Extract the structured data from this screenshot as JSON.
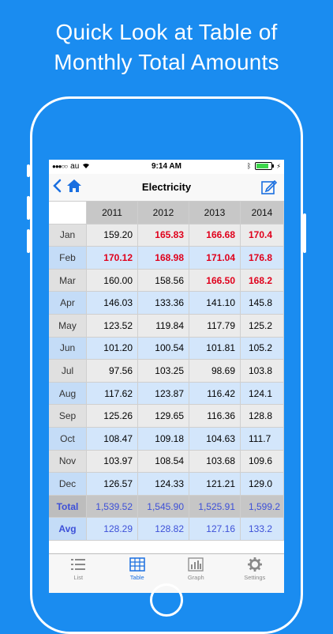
{
  "headline": {
    "line1": "Quick Look at Table of",
    "line2": "Monthly Total Amounts"
  },
  "status": {
    "carrier": "au",
    "time": "9:14 AM"
  },
  "nav": {
    "title": "Electricity"
  },
  "table": {
    "years": [
      "2011",
      "2012",
      "2013",
      "2014"
    ],
    "rows": [
      {
        "month": "Jan",
        "values": [
          "159.20",
          "165.83",
          "166.68",
          "170.4"
        ],
        "red": [
          false,
          true,
          true,
          true
        ]
      },
      {
        "month": "Feb",
        "values": [
          "170.12",
          "168.98",
          "171.04",
          "176.8"
        ],
        "red": [
          true,
          true,
          true,
          true
        ]
      },
      {
        "month": "Mar",
        "values": [
          "160.00",
          "158.56",
          "166.50",
          "168.2"
        ],
        "red": [
          false,
          false,
          true,
          true
        ]
      },
      {
        "month": "Apr",
        "values": [
          "146.03",
          "133.36",
          "141.10",
          "145.8"
        ],
        "red": [
          false,
          false,
          false,
          false
        ]
      },
      {
        "month": "May",
        "values": [
          "123.52",
          "119.84",
          "117.79",
          "125.2"
        ],
        "red": [
          false,
          false,
          false,
          false
        ]
      },
      {
        "month": "Jun",
        "values": [
          "101.20",
          "100.54",
          "101.81",
          "105.2"
        ],
        "red": [
          false,
          false,
          false,
          false
        ]
      },
      {
        "month": "Jul",
        "values": [
          "97.56",
          "103.25",
          "98.69",
          "103.8"
        ],
        "red": [
          false,
          false,
          false,
          false
        ]
      },
      {
        "month": "Aug",
        "values": [
          "117.62",
          "123.87",
          "116.42",
          "124.1"
        ],
        "red": [
          false,
          false,
          false,
          false
        ]
      },
      {
        "month": "Sep",
        "values": [
          "125.26",
          "129.65",
          "116.36",
          "128.8"
        ],
        "red": [
          false,
          false,
          false,
          false
        ]
      },
      {
        "month": "Oct",
        "values": [
          "108.47",
          "109.18",
          "104.63",
          "111.7"
        ],
        "red": [
          false,
          false,
          false,
          false
        ]
      },
      {
        "month": "Nov",
        "values": [
          "103.97",
          "108.54",
          "103.68",
          "109.6"
        ],
        "red": [
          false,
          false,
          false,
          false
        ]
      },
      {
        "month": "Dec",
        "values": [
          "126.57",
          "124.33",
          "121.21",
          "129.0"
        ],
        "red": [
          false,
          false,
          false,
          false
        ]
      }
    ],
    "total": {
      "label": "Total",
      "values": [
        "1,539.52",
        "1,545.90",
        "1,525.91",
        "1,599.2"
      ]
    },
    "avg": {
      "label": "Avg",
      "values": [
        "128.29",
        "128.82",
        "127.16",
        "133.2"
      ]
    }
  },
  "tabs": [
    {
      "label": "List",
      "icon": "list-icon",
      "active": false
    },
    {
      "label": "Table",
      "icon": "table-icon",
      "active": true
    },
    {
      "label": "Graph",
      "icon": "graph-icon",
      "active": false
    },
    {
      "label": "Settings",
      "icon": "gear-icon",
      "active": false
    }
  ],
  "colors": {
    "background": "#1a8cf0",
    "accent": "#1a6fe0",
    "highlight": "#e0001b",
    "summary": "#3d50d8"
  }
}
